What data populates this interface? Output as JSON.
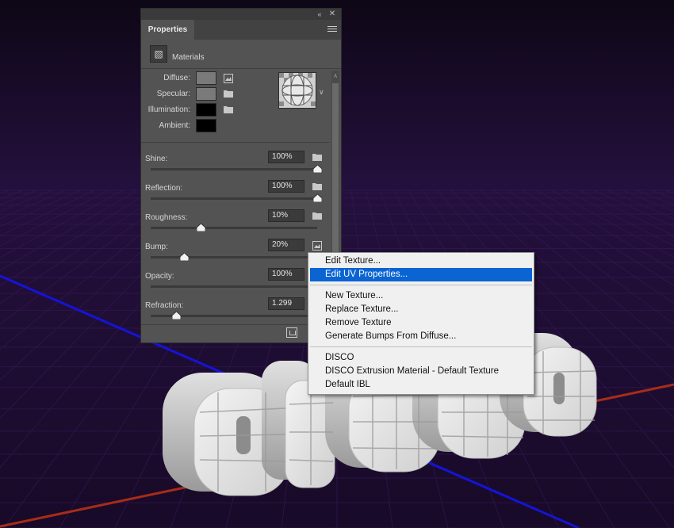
{
  "scene": {
    "text": "DISCO",
    "background_color": "#1c0b2c",
    "grid_color": "#2a1245",
    "axis_blue": "#1010d0",
    "axis_red": "#c23018"
  },
  "panel": {
    "tab_title": "Properties",
    "collapse_icon": "double-chevron-right-icon",
    "close_icon": "close-icon",
    "menu_icon": "hamburger-menu-icon",
    "section_title": "Materials",
    "colors": [
      {
        "label": "Diffuse:",
        "swatch": "#7a7a7a",
        "icon": "texture-image-icon"
      },
      {
        "label": "Specular:",
        "swatch": "#7a7a7a",
        "icon": "folder-icon"
      },
      {
        "label": "Illumination:",
        "swatch": "#000000",
        "icon": "folder-icon"
      },
      {
        "label": "Ambient:",
        "swatch": "#000000",
        "icon": ""
      }
    ],
    "sliders": [
      {
        "label": "Shine:",
        "value": "100%",
        "level": 1.0,
        "icon": "folder-icon"
      },
      {
        "label": "Reflection:",
        "value": "100%",
        "level": 1.0,
        "icon": "folder-icon"
      },
      {
        "label": "Roughness:",
        "value": "10%",
        "level": 0.3,
        "icon": "folder-icon"
      },
      {
        "label": "Bump:",
        "value": "20%",
        "level": 0.2,
        "icon": "texture-image-icon"
      },
      {
        "label": "Opacity:",
        "value": "100%",
        "level": 1.0,
        "icon": ""
      },
      {
        "label": "Refraction:",
        "value": "1.299",
        "level": 0.15,
        "icon": ""
      }
    ],
    "footer_icon": "render-icon"
  },
  "context_menu": {
    "highlighted_index": 1,
    "groups": [
      [
        "Edit Texture...",
        "Edit UV Properties..."
      ],
      [
        "New Texture...",
        "Replace Texture...",
        "Remove Texture",
        "Generate Bumps From Diffuse..."
      ],
      [
        "DISCO",
        "DISCO Extrusion Material - Default Texture",
        "Default IBL"
      ]
    ]
  }
}
